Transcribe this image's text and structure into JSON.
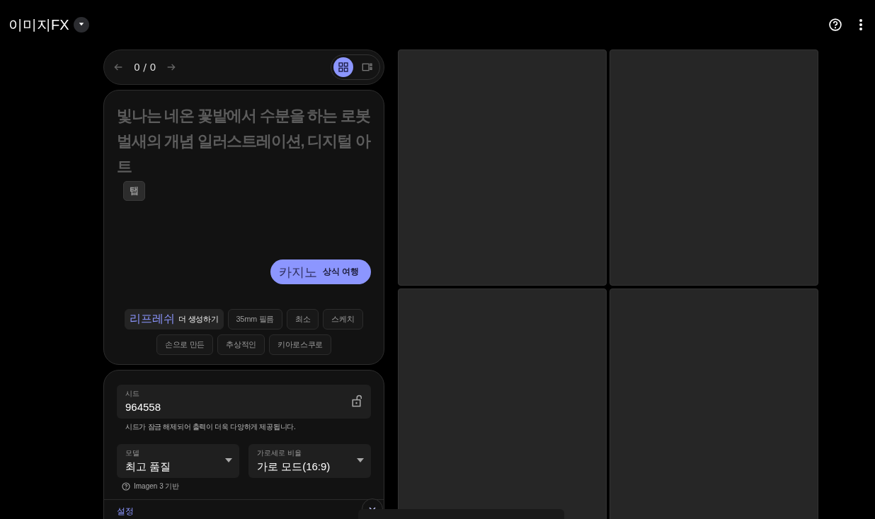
{
  "app": {
    "title": "이미지FX"
  },
  "navigator": {
    "counter": "0 / 0",
    "view_modes": [
      {
        "kind": "grid",
        "selected": true
      },
      {
        "kind": "single",
        "selected": false
      }
    ]
  },
  "prompt": {
    "text": "빛나는 네온 꽃밭에서 수분을 하는 로봇 벌새의 개념 일러스트레이션, 디지털 아트",
    "tab_chip": "탭",
    "suggestion": {
      "label": "카지노",
      "hint": "상식 여행"
    },
    "refresh": {
      "label": "리프레쉬",
      "hint": "더 생성하기"
    },
    "style_chips": [
      "35mm 필름",
      "최소",
      "스케치",
      "손으로 만든",
      "추상적인",
      "키아로스쿠로"
    ]
  },
  "settings": {
    "seed": {
      "label": "시드",
      "value": "964558",
      "locked": false
    },
    "seed_note": "시드가 잠금 해제되어 출력이 더욱 다양하게 제공됩니다.",
    "model": {
      "label": "모델",
      "value": "최고 품질"
    },
    "aspect": {
      "label": "가로세로 비율",
      "value": "가로 모드(16:9)"
    },
    "model_note": "Imagen 3 기반",
    "section": {
      "label": "설정",
      "expanded": false
    }
  }
}
